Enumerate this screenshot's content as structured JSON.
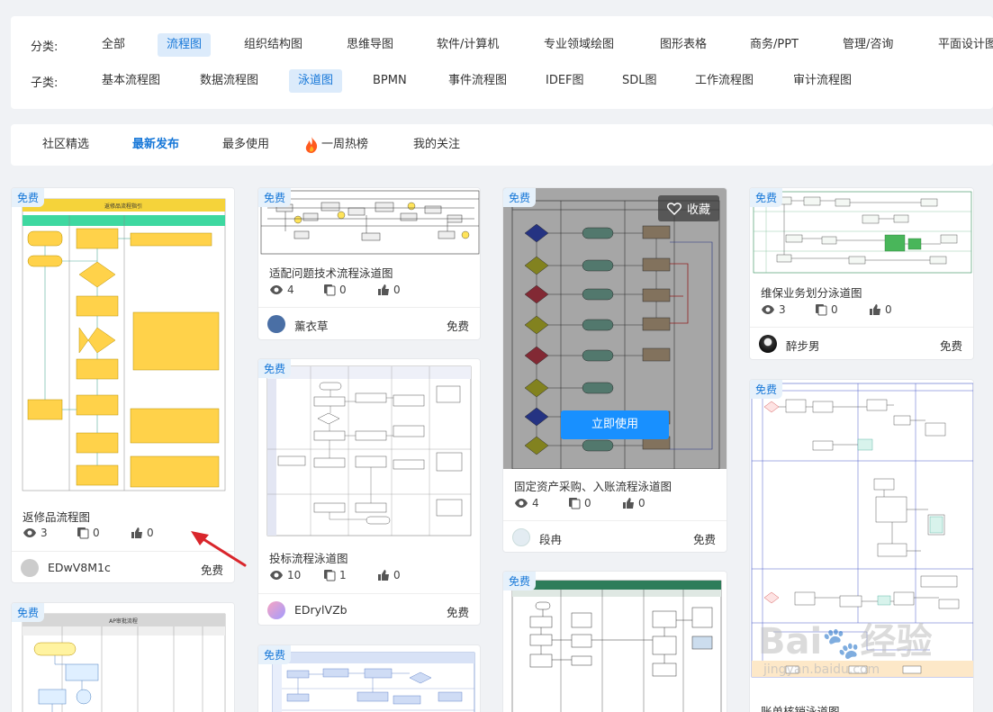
{
  "category": {
    "label": "分类:",
    "items": [
      "全部",
      "流程图",
      "组织结构图",
      "思维导图",
      "软件/计算机",
      "专业领域绘图",
      "图形表格",
      "商务/PPT",
      "管理/咨询",
      "平面设计图"
    ],
    "selected": 1
  },
  "subcategory": {
    "label": "子类:",
    "items": [
      "基本流程图",
      "数据流程图",
      "泳道图",
      "BPMN",
      "事件流程图",
      "IDEF图",
      "SDL图",
      "工作流程图",
      "审计流程图"
    ],
    "selected": 2
  },
  "tabs": [
    "社区精选",
    "最新发布",
    "最多使用",
    "一周热榜",
    "我的关注"
  ],
  "active_tab": 1,
  "cards": {
    "c1": {
      "badge": "免费",
      "title": "返修品流程图",
      "views": "3",
      "copies": "0",
      "likes": "0",
      "user": "EDwV8M1c",
      "price": "免费",
      "thumb_heading": "返修品流程指引"
    },
    "c2": {
      "badge": "免费",
      "title": "适配问题技术流程泳道图",
      "views": "4",
      "copies": "0",
      "likes": "0",
      "user": "薰衣草",
      "price": "免费"
    },
    "c3": {
      "badge": "免费",
      "title": "投标流程泳道图",
      "views": "10",
      "copies": "1",
      "likes": "0",
      "user": "EDrylVZb",
      "price": "免费"
    },
    "c4": {
      "badge": "免费"
    },
    "c5": {
      "badge": "免费",
      "title": "固定资产采购、入账流程泳道图",
      "views": "4",
      "copies": "0",
      "likes": "0",
      "user": "段冉",
      "price": "免费",
      "fav_label": "收藏",
      "use_label": "立即使用"
    },
    "c6": {
      "badge": "免费"
    },
    "c7": {
      "badge": "免费",
      "title": "维保业务划分泳道图",
      "views": "3",
      "copies": "0",
      "likes": "0",
      "user": "醉步男",
      "price": "免费"
    },
    "c8": {
      "badge": "免费",
      "title": "账单核销泳道图"
    },
    "c9": {
      "badge": "免费",
      "thumb_heading": "AP审批流程"
    }
  },
  "colors": {
    "accent": "#1677d8",
    "badge_bg": "#e6f1fb",
    "arrow": "#d9262c"
  }
}
